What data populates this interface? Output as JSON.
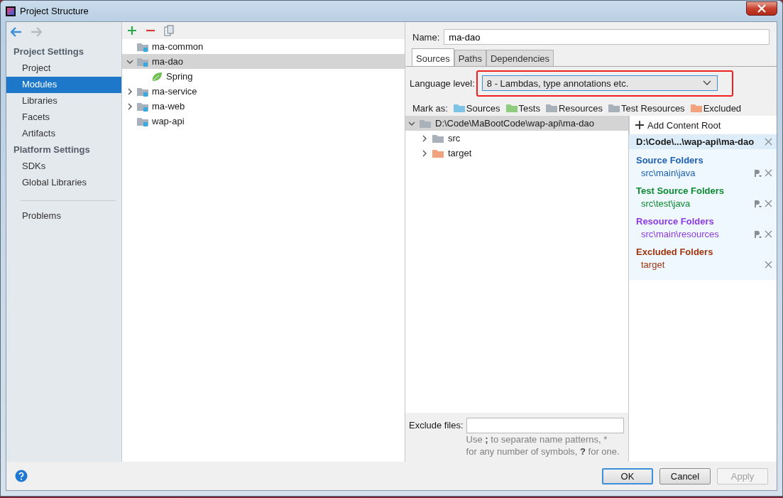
{
  "window": {
    "title": "Project Structure"
  },
  "sidebar": {
    "sections": [
      {
        "heading": "Project Settings",
        "items": [
          {
            "label": "Project",
            "selected": false
          },
          {
            "label": "Modules",
            "selected": true
          },
          {
            "label": "Libraries",
            "selected": false
          },
          {
            "label": "Facets",
            "selected": false
          },
          {
            "label": "Artifacts",
            "selected": false
          }
        ]
      },
      {
        "heading": "Platform Settings",
        "items": [
          {
            "label": "SDKs",
            "selected": false
          },
          {
            "label": "Global Libraries",
            "selected": false
          }
        ]
      }
    ],
    "extra_items": [
      {
        "label": "Problems",
        "selected": false
      }
    ]
  },
  "module_tree": [
    {
      "label": "ma-common",
      "kind": "module",
      "selected": false
    },
    {
      "label": "ma-dao",
      "kind": "module",
      "expanded": true,
      "selected": true,
      "children": [
        {
          "label": "Spring",
          "kind": "facet",
          "selected": false
        }
      ]
    },
    {
      "label": "ma-service",
      "kind": "module",
      "expanded": false,
      "selected": false
    },
    {
      "label": "ma-web",
      "kind": "module",
      "expanded": false,
      "selected": false
    },
    {
      "label": "wap-api",
      "kind": "module",
      "selected": false
    }
  ],
  "name_field": {
    "label": "Name:",
    "value": "ma-dao"
  },
  "tabs": [
    {
      "label": "Sources",
      "selected": true
    },
    {
      "label": "Paths",
      "selected": false
    },
    {
      "label": "Dependencies",
      "selected": false
    }
  ],
  "language_level": {
    "label": "Language level:",
    "value": "8 - Lambdas, type annotations etc.",
    "highlighted": true
  },
  "mark_as": {
    "label": "Mark as:",
    "options": [
      {
        "label": "Sources",
        "color": "#7ec3e6"
      },
      {
        "label": "Tests",
        "color": "#8fcc7e"
      },
      {
        "label": "Resources",
        "color": "#a8b1ba"
      },
      {
        "label": "Test Resources",
        "color": "#a8b1ba"
      },
      {
        "label": "Excluded",
        "color": "#f2a27c"
      }
    ]
  },
  "content_tree": {
    "label": "D:\\Code\\MaBootCode\\wap-api\\ma-dao",
    "expanded": true,
    "selected": true,
    "children": [
      {
        "label": "src",
        "color": "#a8b1ba",
        "expanded": false
      },
      {
        "label": "target",
        "color": "#f2a27c",
        "expanded": false
      }
    ]
  },
  "content_roots": {
    "add_label": "Add Content Root",
    "root_path": "D:\\Code\\...\\wap-api\\ma-dao",
    "groups": [
      {
        "title": "Source Folders",
        "color": "#1b5fb0",
        "folders": [
          {
            "path": "src\\main\\java",
            "has_properties": true
          }
        ]
      },
      {
        "title": "Test Source Folders",
        "color": "#0c8a30",
        "folders": [
          {
            "path": "src\\test\\java",
            "has_properties": true
          }
        ]
      },
      {
        "title": "Resource Folders",
        "color": "#8a3ae0",
        "folders": [
          {
            "path": "src\\main\\resources",
            "has_properties": true
          }
        ]
      },
      {
        "title": "Excluded Folders",
        "color": "#a0340c",
        "folders": [
          {
            "path": "target",
            "has_properties": false
          }
        ]
      }
    ]
  },
  "exclude_files": {
    "label": "Exclude files:",
    "hint": [
      "Use **;** to separate name patterns, *",
      "for any number of symbols, **?** for one."
    ]
  },
  "buttons": [
    {
      "label": "OK",
      "default": true,
      "disabled": false
    },
    {
      "label": "Cancel",
      "default": false,
      "disabled": false
    },
    {
      "label": "Apply",
      "default": false,
      "disabled": true
    }
  ]
}
